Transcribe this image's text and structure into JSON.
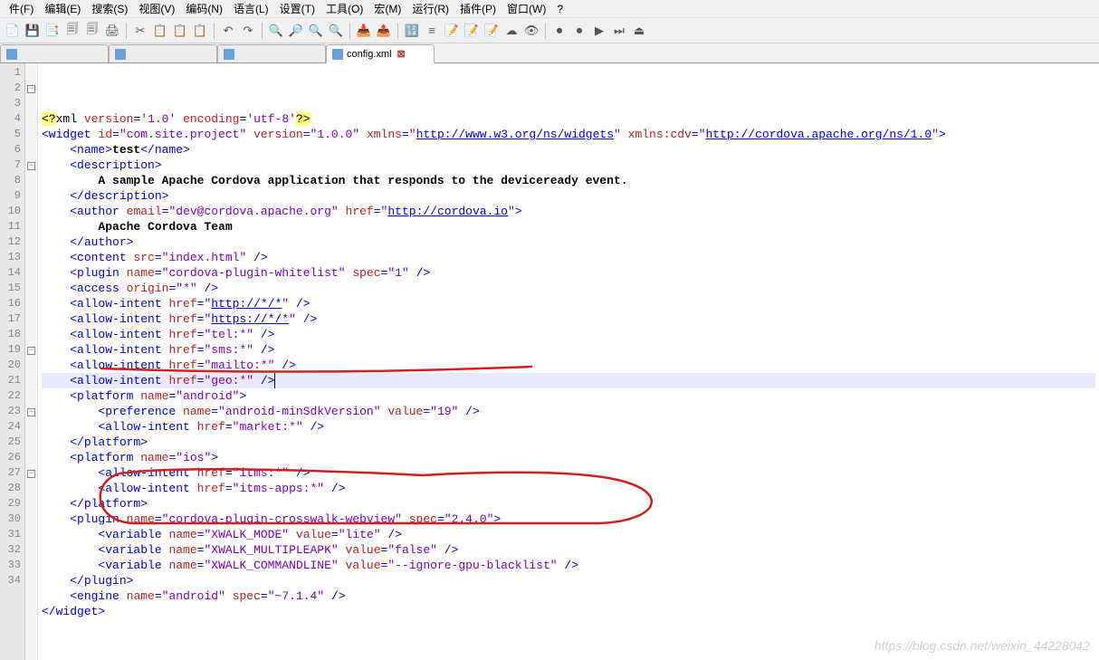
{
  "menu": {
    "items": [
      "件(F)",
      "编辑(E)",
      "搜索(S)",
      "视图(V)",
      "编码(N)",
      "语言(L)",
      "设置(T)",
      "工具(O)",
      "宏(M)",
      "运行(R)",
      "插件(P)",
      "窗口(W)",
      "?"
    ]
  },
  "toolbar": {
    "icons": [
      "📄",
      "💾",
      "📑",
      "🗐",
      "🗐",
      "🖨",
      " | ",
      "✂",
      "📋",
      "📋",
      "📋",
      " | ",
      "↶",
      "↷",
      " | ",
      "🔍",
      "🔎",
      "🔍",
      "🔍",
      " | ",
      "📥",
      "📤",
      " | ",
      "🔢",
      "≡",
      "📝",
      "📝",
      "📝",
      "☁",
      "👁",
      " | ",
      "⏺",
      "⏺",
      "▶",
      "⏭",
      "⏏"
    ]
  },
  "tabs": {
    "items": [
      {
        "label": " ",
        "active": false,
        "closable": false
      },
      {
        "label": " ",
        "active": false,
        "closable": false
      },
      {
        "label": " ",
        "active": false,
        "closable": false
      },
      {
        "label": "config.xml",
        "active": true,
        "closable": true
      }
    ]
  },
  "editor": {
    "highlighted_line": 18,
    "fold_markers": {
      "2": "-",
      "7": "-",
      "19": "-",
      "23": "-",
      "27": "-"
    },
    "lines": [
      {
        "n": 1,
        "seg": [
          [
            "xmldecl",
            "<?"
          ],
          [
            "plain",
            "xml "
          ],
          [
            "attr",
            "version"
          ],
          [
            "plain",
            "="
          ],
          [
            "str",
            "'1.0'"
          ],
          [
            "plain",
            " "
          ],
          [
            "attr",
            "encoding"
          ],
          [
            "plain",
            "="
          ],
          [
            "str",
            "'utf-8'"
          ],
          [
            "xmldecl",
            "?>"
          ]
        ]
      },
      {
        "n": 2,
        "seg": [
          [
            "tag",
            "<widget "
          ],
          [
            "attr",
            "id"
          ],
          [
            "tag",
            "="
          ],
          [
            "str",
            "\"com.site.project\""
          ],
          [
            "tag",
            " "
          ],
          [
            "attr",
            "version"
          ],
          [
            "tag",
            "="
          ],
          [
            "str",
            "\"1.0.0\""
          ],
          [
            "tag",
            " "
          ],
          [
            "attr",
            "xmlns"
          ],
          [
            "tag",
            "="
          ],
          [
            "str",
            "\""
          ],
          [
            "url",
            "http://www.w3.org/ns/widgets"
          ],
          [
            "str",
            "\""
          ],
          [
            "tag",
            " "
          ],
          [
            "attr",
            "xmlns:cdv"
          ],
          [
            "tag",
            "="
          ],
          [
            "str",
            "\""
          ],
          [
            "url",
            "http://cordova.apache.org/ns/1.0"
          ],
          [
            "str",
            "\""
          ],
          [
            "tag",
            ">"
          ]
        ]
      },
      {
        "n": 3,
        "seg": [
          [
            "plain",
            "    "
          ],
          [
            "tag",
            "<name>"
          ],
          [
            "txt",
            "test"
          ],
          [
            "tag",
            "</name>"
          ]
        ]
      },
      {
        "n": 4,
        "seg": [
          [
            "plain",
            "    "
          ],
          [
            "tag",
            "<description>"
          ]
        ]
      },
      {
        "n": 5,
        "seg": [
          [
            "plain",
            "        "
          ],
          [
            "txt",
            "A sample Apache Cordova application that responds to the deviceready event."
          ]
        ]
      },
      {
        "n": 6,
        "seg": [
          [
            "plain",
            "    "
          ],
          [
            "tag",
            "</description>"
          ]
        ]
      },
      {
        "n": 7,
        "seg": [
          [
            "plain",
            "    "
          ],
          [
            "tag",
            "<author "
          ],
          [
            "attr",
            "email"
          ],
          [
            "tag",
            "="
          ],
          [
            "str",
            "\"dev@cordova.apache.org\""
          ],
          [
            "tag",
            " "
          ],
          [
            "attr",
            "href"
          ],
          [
            "tag",
            "="
          ],
          [
            "str",
            "\""
          ],
          [
            "url",
            "http://cordova.io"
          ],
          [
            "str",
            "\""
          ],
          [
            "tag",
            ">"
          ]
        ]
      },
      {
        "n": 8,
        "seg": [
          [
            "plain",
            "        "
          ],
          [
            "txt",
            "Apache Cordova Team"
          ]
        ]
      },
      {
        "n": 9,
        "seg": [
          [
            "plain",
            "    "
          ],
          [
            "tag",
            "</author>"
          ]
        ]
      },
      {
        "n": 10,
        "seg": [
          [
            "plain",
            "    "
          ],
          [
            "tag",
            "<content "
          ],
          [
            "attr",
            "src"
          ],
          [
            "tag",
            "="
          ],
          [
            "str",
            "\"index.html\""
          ],
          [
            "tag",
            " />"
          ]
        ]
      },
      {
        "n": 11,
        "seg": [
          [
            "plain",
            "    "
          ],
          [
            "tag",
            "<plugin "
          ],
          [
            "attr",
            "name"
          ],
          [
            "tag",
            "="
          ],
          [
            "str",
            "\"cordova-plugin-whitelist\""
          ],
          [
            "tag",
            " "
          ],
          [
            "attr",
            "spec"
          ],
          [
            "tag",
            "="
          ],
          [
            "str",
            "\"1\""
          ],
          [
            "tag",
            " />"
          ]
        ]
      },
      {
        "n": 12,
        "seg": [
          [
            "plain",
            "    "
          ],
          [
            "tag",
            "<access "
          ],
          [
            "attr",
            "origin"
          ],
          [
            "tag",
            "="
          ],
          [
            "str",
            "\"*\""
          ],
          [
            "tag",
            " />"
          ]
        ]
      },
      {
        "n": 13,
        "seg": [
          [
            "plain",
            "    "
          ],
          [
            "tag",
            "<allow-intent "
          ],
          [
            "attr",
            "href"
          ],
          [
            "tag",
            "="
          ],
          [
            "str",
            "\""
          ],
          [
            "url",
            "http://*/*"
          ],
          [
            "str",
            "\""
          ],
          [
            "tag",
            " />"
          ]
        ]
      },
      {
        "n": 14,
        "seg": [
          [
            "plain",
            "    "
          ],
          [
            "tag",
            "<allow-intent "
          ],
          [
            "attr",
            "href"
          ],
          [
            "tag",
            "="
          ],
          [
            "str",
            "\""
          ],
          [
            "url",
            "https://*/*"
          ],
          [
            "str",
            "\""
          ],
          [
            "tag",
            " />"
          ]
        ]
      },
      {
        "n": 15,
        "seg": [
          [
            "plain",
            "    "
          ],
          [
            "tag",
            "<allow-intent "
          ],
          [
            "attr",
            "href"
          ],
          [
            "tag",
            "="
          ],
          [
            "str",
            "\"tel:*\""
          ],
          [
            "tag",
            " />"
          ]
        ]
      },
      {
        "n": 16,
        "seg": [
          [
            "plain",
            "    "
          ],
          [
            "tag",
            "<allow-intent "
          ],
          [
            "attr",
            "href"
          ],
          [
            "tag",
            "="
          ],
          [
            "str",
            "\"sms:*\""
          ],
          [
            "tag",
            " />"
          ]
        ]
      },
      {
        "n": 17,
        "seg": [
          [
            "plain",
            "    "
          ],
          [
            "tag",
            "<allow-intent "
          ],
          [
            "attr",
            "href"
          ],
          [
            "tag",
            "="
          ],
          [
            "str",
            "\"mailto:*\""
          ],
          [
            "tag",
            " />"
          ]
        ]
      },
      {
        "n": 18,
        "seg": [
          [
            "plain",
            "    "
          ],
          [
            "tag",
            "<allow-intent "
          ],
          [
            "attr",
            "href"
          ],
          [
            "tag",
            "="
          ],
          [
            "str",
            "\"geo:*\""
          ],
          [
            "tag",
            " />"
          ]
        ]
      },
      {
        "n": 19,
        "seg": [
          [
            "plain",
            "    "
          ],
          [
            "tag",
            "<platform "
          ],
          [
            "attr",
            "name"
          ],
          [
            "tag",
            "="
          ],
          [
            "str",
            "\"android\""
          ],
          [
            "tag",
            ">"
          ]
        ]
      },
      {
        "n": 20,
        "seg": [
          [
            "plain",
            "        "
          ],
          [
            "tag",
            "<preference "
          ],
          [
            "attr",
            "name"
          ],
          [
            "tag",
            "="
          ],
          [
            "str",
            "\"android-minSdkVersion\""
          ],
          [
            "tag",
            " "
          ],
          [
            "attr",
            "value"
          ],
          [
            "tag",
            "="
          ],
          [
            "str",
            "\"19\""
          ],
          [
            "tag",
            " />"
          ]
        ]
      },
      {
        "n": 21,
        "seg": [
          [
            "plain",
            "        "
          ],
          [
            "tag",
            "<allow-intent "
          ],
          [
            "attr",
            "href"
          ],
          [
            "tag",
            "="
          ],
          [
            "str",
            "\"market:*\""
          ],
          [
            "tag",
            " />"
          ]
        ]
      },
      {
        "n": 22,
        "seg": [
          [
            "plain",
            "    "
          ],
          [
            "tag",
            "</platform>"
          ]
        ]
      },
      {
        "n": 23,
        "seg": [
          [
            "plain",
            "    "
          ],
          [
            "tag",
            "<platform "
          ],
          [
            "attr",
            "name"
          ],
          [
            "tag",
            "="
          ],
          [
            "str",
            "\"ios\""
          ],
          [
            "tag",
            ">"
          ]
        ]
      },
      {
        "n": 24,
        "seg": [
          [
            "plain",
            "        "
          ],
          [
            "tag",
            "<allow-intent "
          ],
          [
            "attr",
            "href"
          ],
          [
            "tag",
            "="
          ],
          [
            "str",
            "\"itms:*\""
          ],
          [
            "tag",
            " />"
          ]
        ]
      },
      {
        "n": 25,
        "seg": [
          [
            "plain",
            "        "
          ],
          [
            "tag",
            "<allow-intent "
          ],
          [
            "attr",
            "href"
          ],
          [
            "tag",
            "="
          ],
          [
            "str",
            "\"itms-apps:*\""
          ],
          [
            "tag",
            " />"
          ]
        ]
      },
      {
        "n": 26,
        "seg": [
          [
            "plain",
            "    "
          ],
          [
            "tag",
            "</platform>"
          ]
        ]
      },
      {
        "n": 27,
        "seg": [
          [
            "plain",
            "    "
          ],
          [
            "tag",
            "<plugin "
          ],
          [
            "attr",
            "name"
          ],
          [
            "tag",
            "="
          ],
          [
            "str",
            "\"cordova-plugin-crosswalk-webview\""
          ],
          [
            "tag",
            " "
          ],
          [
            "attr",
            "spec"
          ],
          [
            "tag",
            "="
          ],
          [
            "str",
            "\"2.4.0\""
          ],
          [
            "tag",
            ">"
          ]
        ]
      },
      {
        "n": 28,
        "seg": [
          [
            "plain",
            "        "
          ],
          [
            "tag",
            "<variable "
          ],
          [
            "attr",
            "name"
          ],
          [
            "tag",
            "="
          ],
          [
            "str",
            "\"XWALK_MODE\""
          ],
          [
            "tag",
            " "
          ],
          [
            "attr",
            "value"
          ],
          [
            "tag",
            "="
          ],
          [
            "str",
            "\"lite\""
          ],
          [
            "tag",
            " />"
          ]
        ]
      },
      {
        "n": 29,
        "seg": [
          [
            "plain",
            "        "
          ],
          [
            "tag",
            "<variable "
          ],
          [
            "attr",
            "name"
          ],
          [
            "tag",
            "="
          ],
          [
            "str",
            "\"XWALK_MULTIPLEAPK\""
          ],
          [
            "tag",
            " "
          ],
          [
            "attr",
            "value"
          ],
          [
            "tag",
            "="
          ],
          [
            "str",
            "\"false\""
          ],
          [
            "tag",
            " />"
          ]
        ]
      },
      {
        "n": 30,
        "seg": [
          [
            "plain",
            "        "
          ],
          [
            "tag",
            "<variable "
          ],
          [
            "attr",
            "name"
          ],
          [
            "tag",
            "="
          ],
          [
            "str",
            "\"XWALK_COMMANDLINE\""
          ],
          [
            "tag",
            " "
          ],
          [
            "attr",
            "value"
          ],
          [
            "tag",
            "="
          ],
          [
            "str",
            "\"--ignore-gpu-blacklist\""
          ],
          [
            "tag",
            " />"
          ]
        ]
      },
      {
        "n": 31,
        "seg": [
          [
            "plain",
            "    "
          ],
          [
            "tag",
            "</plugin>"
          ]
        ]
      },
      {
        "n": 32,
        "seg": [
          [
            "plain",
            "    "
          ],
          [
            "tag",
            "<engine "
          ],
          [
            "attr",
            "name"
          ],
          [
            "tag",
            "="
          ],
          [
            "str",
            "\"android\""
          ],
          [
            "tag",
            " "
          ],
          [
            "attr",
            "spec"
          ],
          [
            "tag",
            "="
          ],
          [
            "str",
            "\"~7.1.4\""
          ],
          [
            "tag",
            " />"
          ]
        ]
      },
      {
        "n": 33,
        "seg": [
          [
            "tag",
            "</widget>"
          ]
        ]
      },
      {
        "n": 34,
        "seg": [
          [
            "plain",
            ""
          ]
        ]
      }
    ]
  },
  "watermark": "https://blog.csdn.net/weixin_44228042"
}
